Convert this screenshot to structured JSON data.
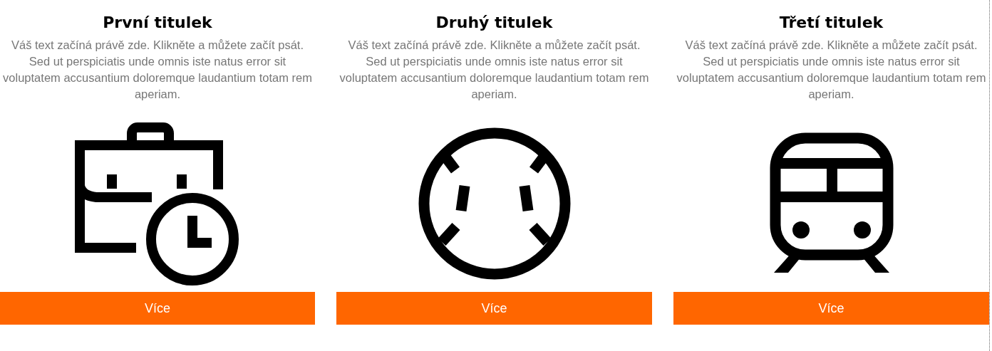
{
  "cards": [
    {
      "title": "První titulek",
      "text": "Váš text začíná právě zde. Klikněte a můžete začít psát. Sed ut perspiciatis unde omnis iste natus error sit voluptatem accusantium doloremque laudantium totam rem aperiam.",
      "kind": "briefcase-clock",
      "button": "Více"
    },
    {
      "title": "Druhý titulek",
      "text": "Váš text začíná právě zde. Klikněte a můžete začít psát. Sed ut perspiciatis unde omnis iste natus error sit voluptatem accusantium doloremque laudantium totam rem aperiam.",
      "kind": "baseball",
      "button": "Více"
    },
    {
      "title": "Třetí titulek",
      "text": "Váš text začíná právě zde. Klikněte a můžete začít psát. Sed ut perspiciatis unde omnis iste natus error sit voluptatem accusantium doloremque laudantium totam rem aperiam.",
      "kind": "train",
      "button": "Více"
    }
  ]
}
